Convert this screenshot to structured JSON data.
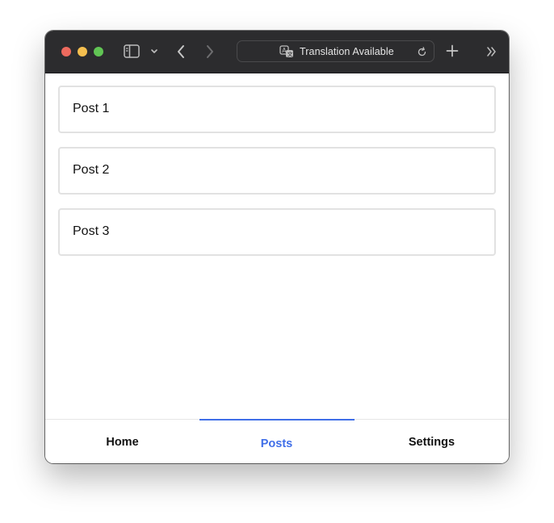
{
  "browser": {
    "address_text": "Translation Available",
    "colors": {
      "titlebar": "#2c2c2e",
      "close": "#ed6a5e",
      "minimize": "#f5bf4f",
      "maximize": "#61c554"
    },
    "icons": [
      "sidebar-icon",
      "chevron-down-icon",
      "back-arrow-icon",
      "forward-arrow-icon",
      "translate-icon",
      "reload-icon",
      "plus-icon",
      "double-chevron-right-icon"
    ]
  },
  "posts": [
    {
      "title": "Post 1"
    },
    {
      "title": "Post 2"
    },
    {
      "title": "Post 3"
    }
  ],
  "tabs": [
    {
      "label": "Home",
      "active": false
    },
    {
      "label": "Posts",
      "active": true
    },
    {
      "label": "Settings",
      "active": false
    }
  ],
  "accent_color": "#3f6ee8"
}
